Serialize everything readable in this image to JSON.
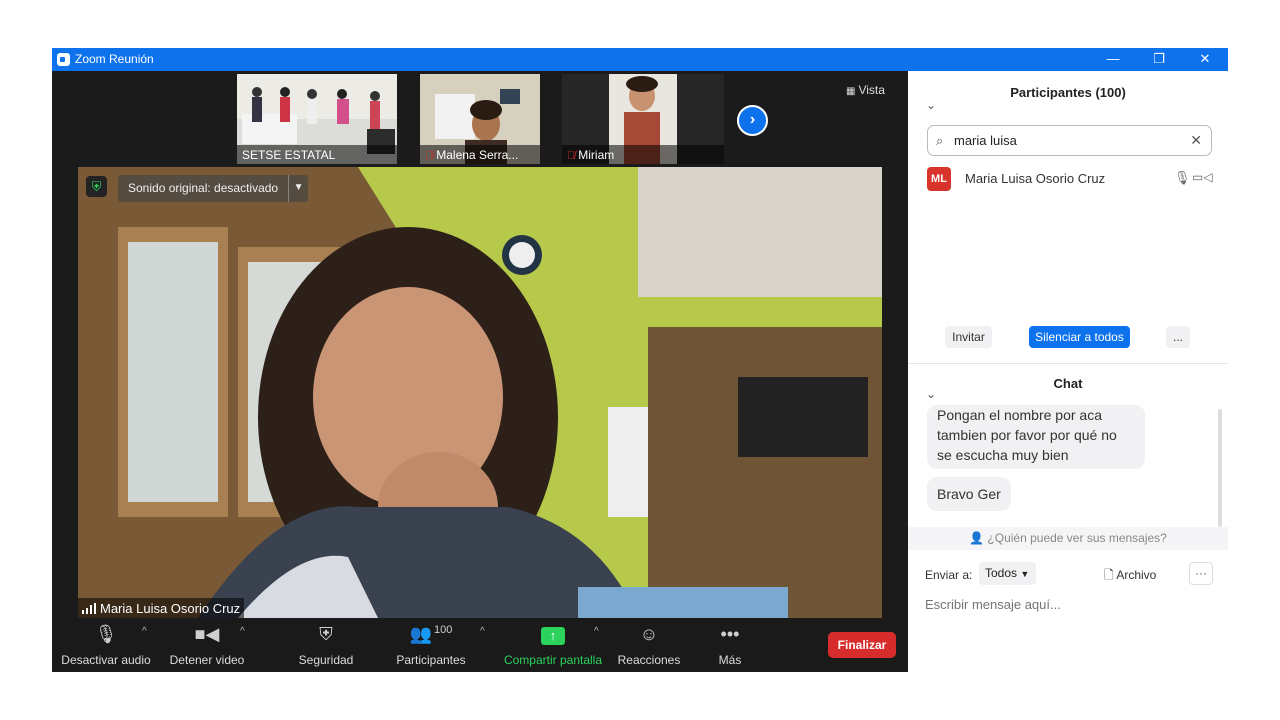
{
  "window": {
    "title": "Zoom Reunión",
    "minimize": "—",
    "restore": "❐",
    "close": "✕"
  },
  "gallery": {
    "thumbs": [
      {
        "name": "SETSE ESTATAL",
        "muted": false
      },
      {
        "name": "Malena Serra...",
        "muted": true
      },
      {
        "name": "Miriam",
        "muted": true
      }
    ],
    "view_label": "Vista"
  },
  "main_video": {
    "speaker": "Maria Luisa Osorio Cruz",
    "sound_label": "Sonido original: desactivado"
  },
  "toolbar": {
    "audio": "Desactivar audio",
    "video": "Detener video",
    "security": "Seguridad",
    "participants": "Participantes",
    "participants_count": "100",
    "share": "Compartir pantalla",
    "reactions": "Reacciones",
    "more": "Más",
    "end": "Finalizar"
  },
  "participants_panel": {
    "title": "Participantes (100)",
    "search_value": "maria luisa",
    "rows": [
      {
        "initials": "ML",
        "name": "Maria Luisa Osorio Cruz"
      }
    ],
    "invite": "Invitar",
    "mute_all": "Silenciar a todos",
    "more": "..."
  },
  "chat": {
    "title": "Chat",
    "messages": [
      "Pongan el nombre por aca tambien por favor por qué no se escucha muy bien",
      "Bravo Ger"
    ],
    "who_sees": "¿Quién puede ver sus mensajes?",
    "send_to_label": "Enviar a:",
    "send_to_value": "Todos",
    "file_label": "Archivo",
    "placeholder": "Escribir mensaje aquí..."
  },
  "colors": {
    "accent": "#0e72ed",
    "end": "#d62c2c",
    "share": "#2bd25c",
    "mute": "#e02828"
  }
}
